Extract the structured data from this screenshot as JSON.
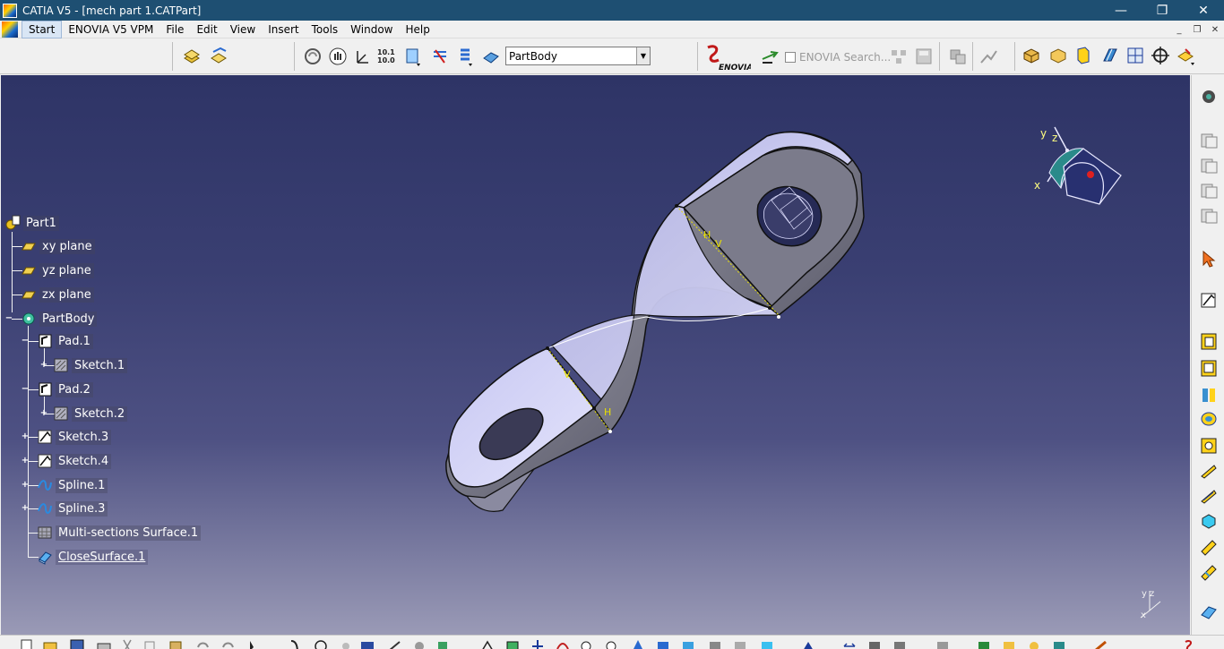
{
  "window": {
    "title": "CATIA V5 - [mech part 1.CATPart]",
    "controls": {
      "minimize": "—",
      "maximize": "❐",
      "close": "✕"
    }
  },
  "menu": {
    "items": [
      "Start",
      "ENOVIA V5 VPM",
      "File",
      "Edit",
      "View",
      "Insert",
      "Tools",
      "Window",
      "Help"
    ],
    "mdi": {
      "minimize": "_",
      "restore": "❐",
      "close": "✕"
    }
  },
  "toolbar": {
    "body_selector": {
      "value": "PartBody"
    },
    "enovia_search": {
      "label": "ENOVIA Search..."
    }
  },
  "tree": {
    "nodes": [
      {
        "label": "Part1",
        "icon": "part-icon"
      },
      {
        "label": "xy plane",
        "icon": "plane-icon"
      },
      {
        "label": "yz plane",
        "icon": "plane-icon"
      },
      {
        "label": "zx plane",
        "icon": "plane-icon"
      },
      {
        "label": "PartBody",
        "icon": "body-icon"
      },
      {
        "label": "Pad.1",
        "icon": "pad-icon"
      },
      {
        "label": "Sketch.1",
        "icon": "sketch-icon"
      },
      {
        "label": "Pad.2",
        "icon": "pad-icon"
      },
      {
        "label": "Sketch.2",
        "icon": "sketch-icon"
      },
      {
        "label": "Sketch.3",
        "icon": "sketch-icon"
      },
      {
        "label": "Sketch.4",
        "icon": "sketch-icon"
      },
      {
        "label": "Spline.1",
        "icon": "spline-icon"
      },
      {
        "label": "Spline.3",
        "icon": "spline-icon"
      },
      {
        "label": "Multi-sections Surface.1",
        "icon": "multi-sections-surface-icon"
      },
      {
        "label": "CloseSurface.1",
        "icon": "close-surface-icon"
      }
    ]
  },
  "model": {
    "labels": {
      "h1": "H",
      "v1": "V",
      "v2": "V",
      "h2": "H"
    }
  },
  "compass": {
    "x": "x",
    "y": "y",
    "z": "z"
  },
  "mini_axis": {
    "y": "y",
    "z": "z",
    "x": "x"
  },
  "colors": {
    "titlebar": "#1e4f72",
    "viewport_top": "#2e3466",
    "viewport_bottom": "#9a9ab6",
    "part_light": "#c9c9ef",
    "part_dark": "#6d6d80",
    "annotation": "#e8e000"
  }
}
